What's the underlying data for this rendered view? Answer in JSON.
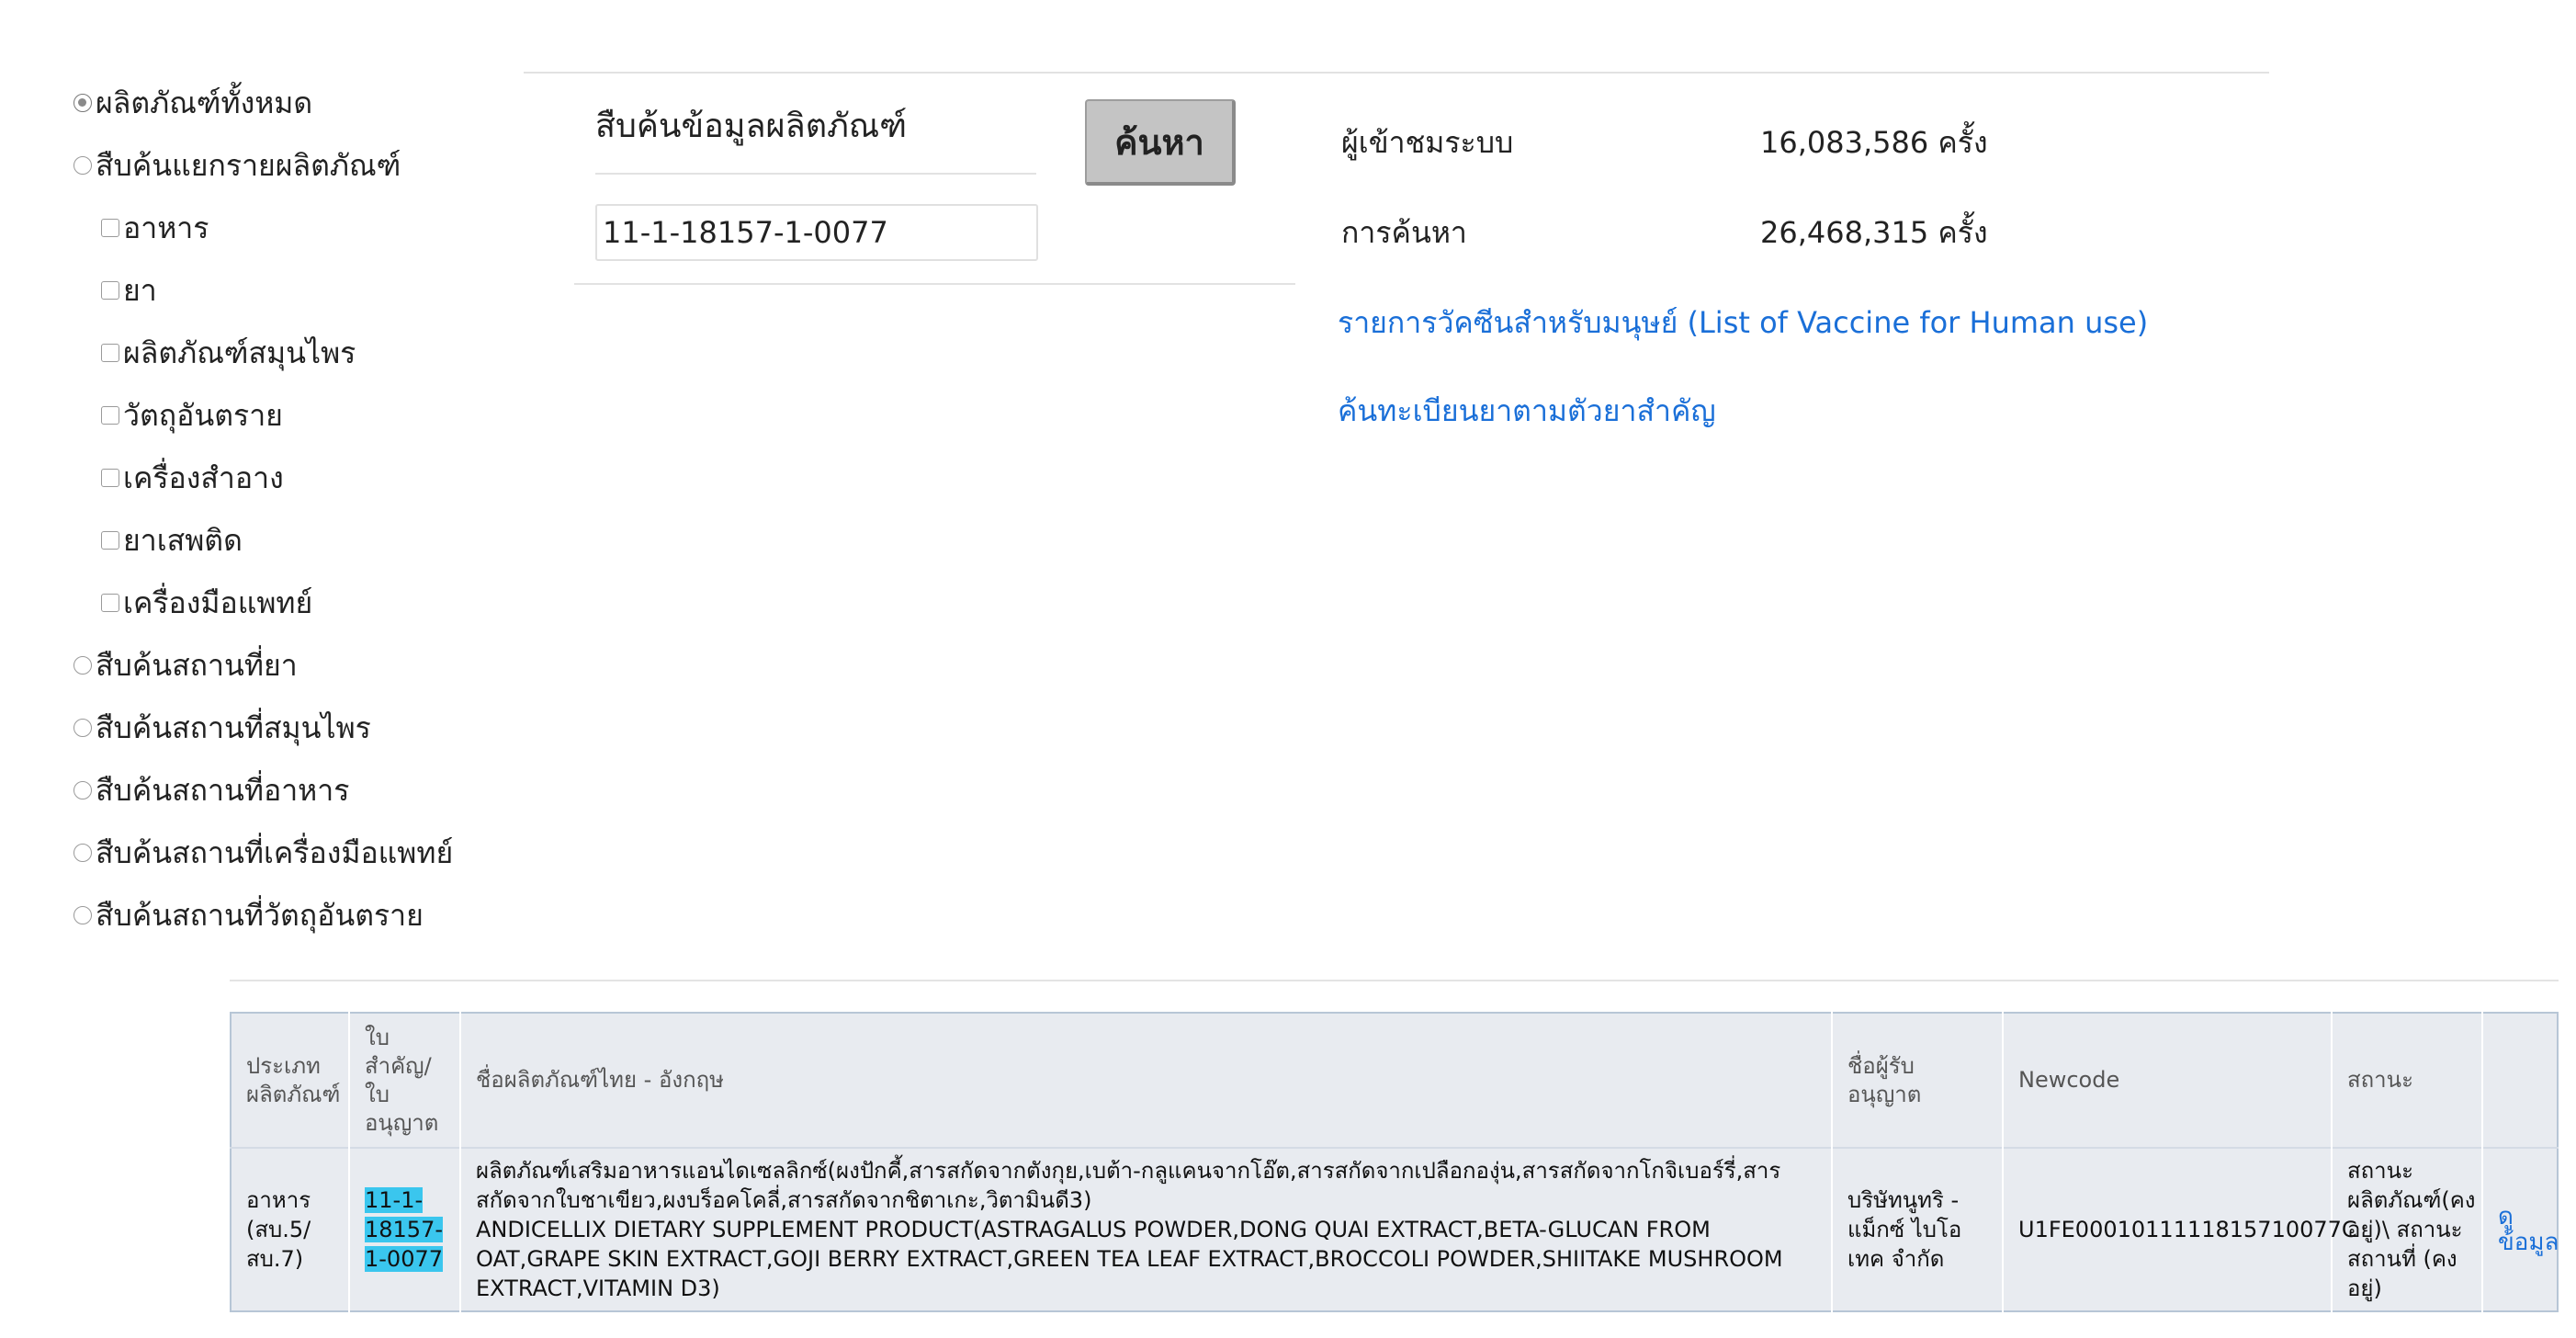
{
  "menu": {
    "all_products": "ผลิตภัณฑ์ทั้งหมด",
    "by_product": "สืบค้นแยกรายผลิตภัณฑ์",
    "categories": [
      "อาหาร",
      "ยา",
      "ผลิตภัณฑ์สมุนไพร",
      "วัตถุอันตราย",
      "เครื่องสำอาง",
      "ยาเสพติด",
      "เครื่องมือแพทย์"
    ],
    "places": [
      "สืบค้นสถานที่ยา",
      "สืบค้นสถานที่สมุนไพร",
      "สืบค้นสถานที่อาหาร",
      "สืบค้นสถานที่เครื่องมือแพทย์",
      "สืบค้นสถานที่วัตถุอันตราย"
    ]
  },
  "search": {
    "label": "สืบค้นข้อมูลผลิตภัณฑ์",
    "value": "11-1-18157-1-0077",
    "button_label": "ค้นหา"
  },
  "stats": {
    "visitors_label": "ผู้เข้าชมระบบ",
    "visitors_value": "16,083,586 ครั้ง",
    "searches_label": "การค้นหา",
    "searches_value": "26,468,315 ครั้ง"
  },
  "links": {
    "vaccine": "รายการวัคซีนสำหรับมนุษย์ (List of Vaccine for Human use)",
    "drug_by_ingredient": "ค้นทะเบียนยาตามตัวยาสำคัญ"
  },
  "table": {
    "headers": {
      "type": "ประเภท ผลิตภัณฑ์",
      "license": "ใบ สำคัญ/ ใบ อนุญาต",
      "name": "ชื่อผลิตภัณฑ์ไทย - อังกฤษ",
      "licensee": "ชื่อผู้รับอนุญาต",
      "newcode": "Newcode",
      "status": "สถานะ"
    },
    "rows": [
      {
        "type": "อาหาร (สบ.5/ สบ.7)",
        "license": "11-1- 18157- 1-0077",
        "name_th": "ผลิตภัณฑ์เสริมอาหารแอนไดเซลลิกซ์(ผงปักคี้,สารสกัดจากตังกุย,เบต้า-กลูแคนจากโอ๊ต,สารสกัดจากเปลือกองุ่น,สารสกัดจากโกจิเบอร์รี่,สารสกัดจากใบชาเขียว,ผงบร็อคโคลี่,สารสกัดจากชิตาเกะ,วิตามินดี3)",
        "name_en": "ANDICELLIX DIETARY SUPPLEMENT PRODUCT(ASTRAGALUS POWDER,DONG QUAI EXTRACT,BETA-GLUCAN FROM OAT,GRAPE SKIN EXTRACT,GOJI BERRY EXTRACT,GREEN TEA LEAF EXTRACT,BROCCOLI POWDER,SHIITAKE MUSHROOM EXTRACT,VITAMIN D3)",
        "licensee": "บริษัทนูทริ - แม็กซ์ ไบโอ เทค จำกัด",
        "newcode": "U1FE0001011111815710077C",
        "status": "สถานะ ผลิตภัณฑ์(คง อยู่)\\ สถานะ สถานที่ (คง อยู่)",
        "view_label": "ดู ข้อมูล"
      }
    ]
  }
}
